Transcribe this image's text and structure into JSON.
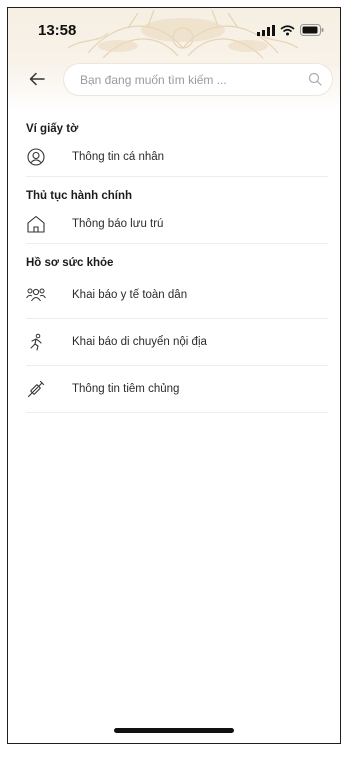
{
  "status": {
    "time": "13:58"
  },
  "search": {
    "placeholder": "Bạn đang muốn tìm kiếm ..."
  },
  "sections": [
    {
      "title": "Ví giấy tờ",
      "items": [
        {
          "label": "Thông tin cá nhân",
          "icon": "user-circle-icon"
        }
      ]
    },
    {
      "title": "Thủ tục hành chính",
      "items": [
        {
          "label": "Thông báo lưu trú",
          "icon": "home-icon"
        }
      ]
    },
    {
      "title": "Hồ sơ sức khỏe",
      "items": [
        {
          "label": "Khai báo y tế toàn dân",
          "icon": "people-group-icon"
        },
        {
          "label": "Khai báo di chuyển nội địa",
          "icon": "running-person-icon"
        },
        {
          "label": "Thông tin tiêm chủng",
          "icon": "syringe-icon"
        }
      ]
    }
  ],
  "colors": {
    "header_bg": "#f6efe3",
    "pattern": "#e7d3b4",
    "divider": "#ededed",
    "text": "#2b2b2b"
  }
}
